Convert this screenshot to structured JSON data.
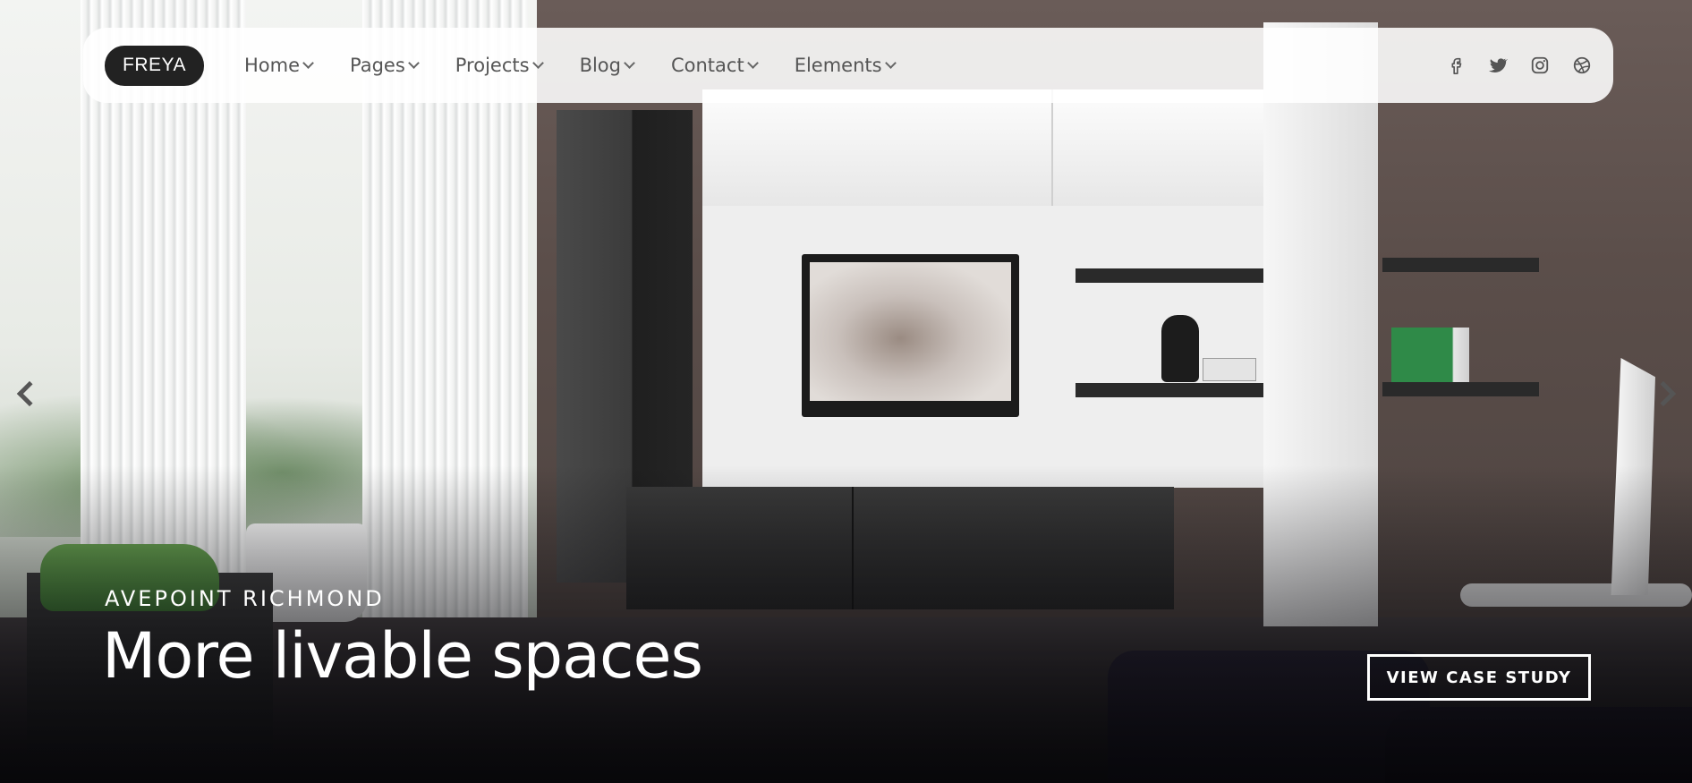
{
  "brand": {
    "logo_text": "FREYA"
  },
  "nav": {
    "items": [
      {
        "label": "Home"
      },
      {
        "label": "Pages"
      },
      {
        "label": "Projects"
      },
      {
        "label": "Blog"
      },
      {
        "label": "Contact"
      },
      {
        "label": "Elements"
      }
    ]
  },
  "socials": [
    {
      "icon": "facebook-icon"
    },
    {
      "icon": "twitter-icon"
    },
    {
      "icon": "instagram-icon"
    },
    {
      "icon": "dribbble-icon"
    }
  ],
  "slide": {
    "subtitle": "AVEPOINT RICHMOND",
    "title": "More livable spaces",
    "cta_label": "VIEW CASE STUDY"
  },
  "colors": {
    "logo_bg": "#222222",
    "nav_bg": "#ffffff",
    "text_light": "#ffffff"
  }
}
